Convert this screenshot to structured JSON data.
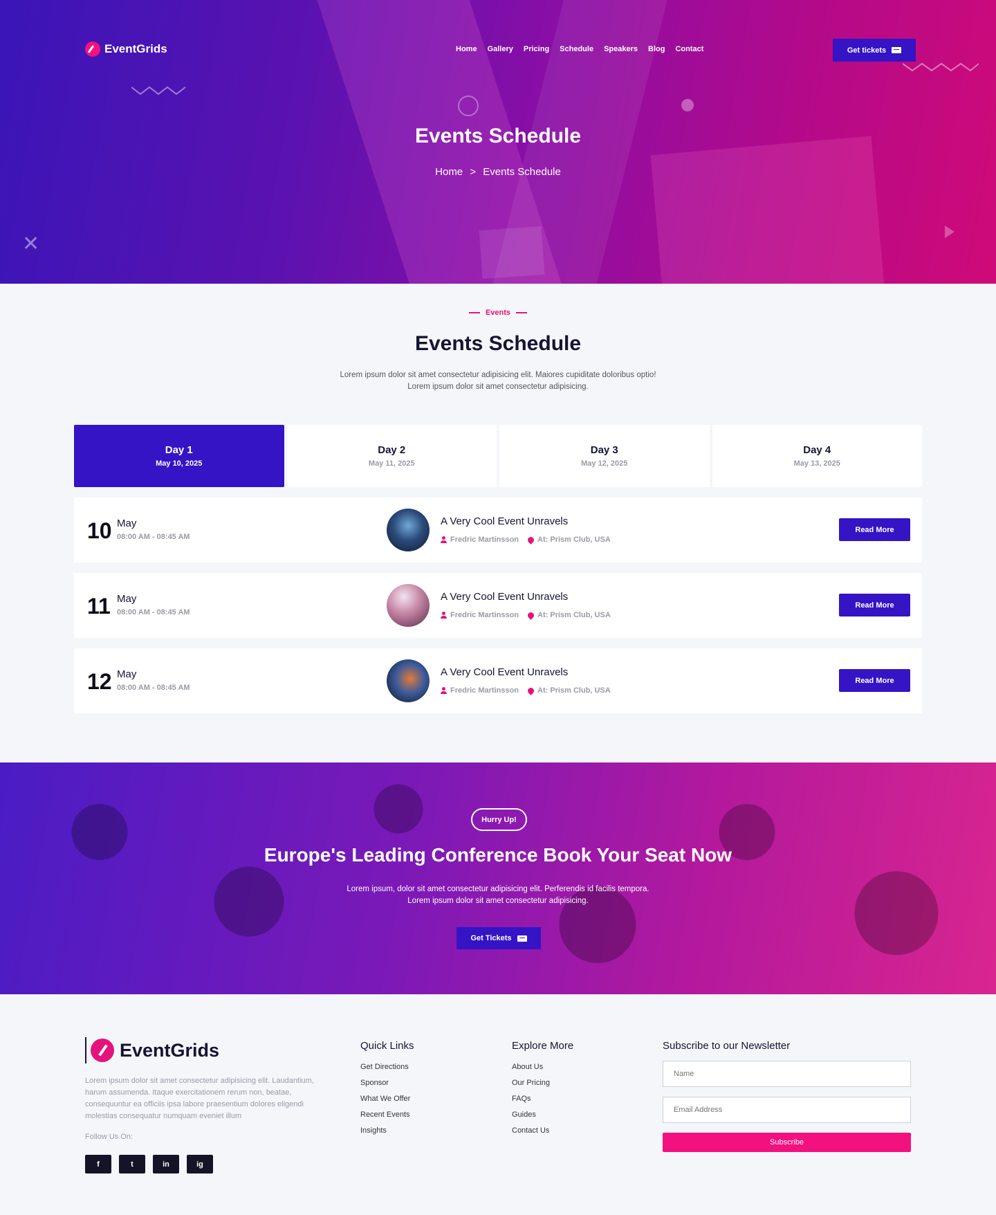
{
  "brand": "EventGrids",
  "nav": {
    "items": [
      "Home",
      "Gallery",
      "Pricing",
      "Schedule",
      "Speakers",
      "Blog",
      "Contact"
    ],
    "cta": "Get tickets"
  },
  "hero": {
    "title": "Events Schedule",
    "breadcrumb_home": "Home",
    "breadcrumb_sep": ">",
    "breadcrumb_current": "Events Schedule"
  },
  "events": {
    "eyebrow": "Events",
    "title": "Events Schedule",
    "desc_line1": "Lorem ipsum dolor sit amet consectetur adipisicing elit. Maiores cupiditate doloribus optio!",
    "desc_line2": "Lorem ipsum dolor sit amet consectetur adipisicing.",
    "tabs": [
      {
        "label": "Day 1",
        "date": "May 10, 2025",
        "active": true
      },
      {
        "label": "Day 2",
        "date": "May 11, 2025",
        "active": false
      },
      {
        "label": "Day 3",
        "date": "May 12, 2025",
        "active": false
      },
      {
        "label": "Day 4",
        "date": "May 13, 2025",
        "active": false
      }
    ],
    "rows": [
      {
        "day": "10",
        "month": "May",
        "time": "08:00 AM - 08:45 AM",
        "title": "A Very Cool Event Unravels",
        "speaker": "Fredric Martinsson",
        "location": "At: Prism Club, USA",
        "button": "Read More"
      },
      {
        "day": "11",
        "month": "May",
        "time": "08:00 AM - 08:45 AM",
        "title": "A Very Cool Event Unravels",
        "speaker": "Fredric Martinsson",
        "location": "At: Prism Club, USA",
        "button": "Read More"
      },
      {
        "day": "12",
        "month": "May",
        "time": "08:00 AM - 08:45 AM",
        "title": "A Very Cool Event Unravels",
        "speaker": "Fredric Martinsson",
        "location": "At: Prism Club, USA",
        "button": "Read More"
      }
    ]
  },
  "cta": {
    "badge": "Hurry Up!",
    "title": "Europe's Leading Conference Book Your Seat Now",
    "desc_line1": "Lorem ipsum, dolor sit amet consectetur adipisicing elit. Perferendis id facilis tempora.",
    "desc_line2": "Lorem ipsum dolor sit amet consectetur adipisicing.",
    "button": "Get Tickets"
  },
  "footer": {
    "brand": "EventGrids",
    "about": "Lorem ipsum dolor sit amet consectetur adipisicing elit. Laudantium, harum assumenda. Itaque exercitationem rerum non, beatae, consequuntur ea officiis ipsa labore praesentium dolores eligendi molestias consequatur numquam eveniet illum",
    "follow": "Follow Us On:",
    "socials": [
      "f",
      "t",
      "in",
      "ig"
    ],
    "quick_title": "Quick Links",
    "quick_links": [
      "Get Directions",
      "Sponsor",
      "What We Offer",
      "Recent Events",
      "Insights"
    ],
    "explore_title": "Explore More",
    "explore_links": [
      "About Us",
      "Our Pricing",
      "FAQs",
      "Guides",
      "Contact Us"
    ],
    "newsletter_title": "Subscribe to our Newsletter",
    "name_placeholder": "Name",
    "email_placeholder": "Email Address",
    "subscribe": "Subscribe"
  },
  "colors": {
    "primary": "#3414c4",
    "accent": "#e5127c",
    "pink_button": "#f2117f"
  }
}
